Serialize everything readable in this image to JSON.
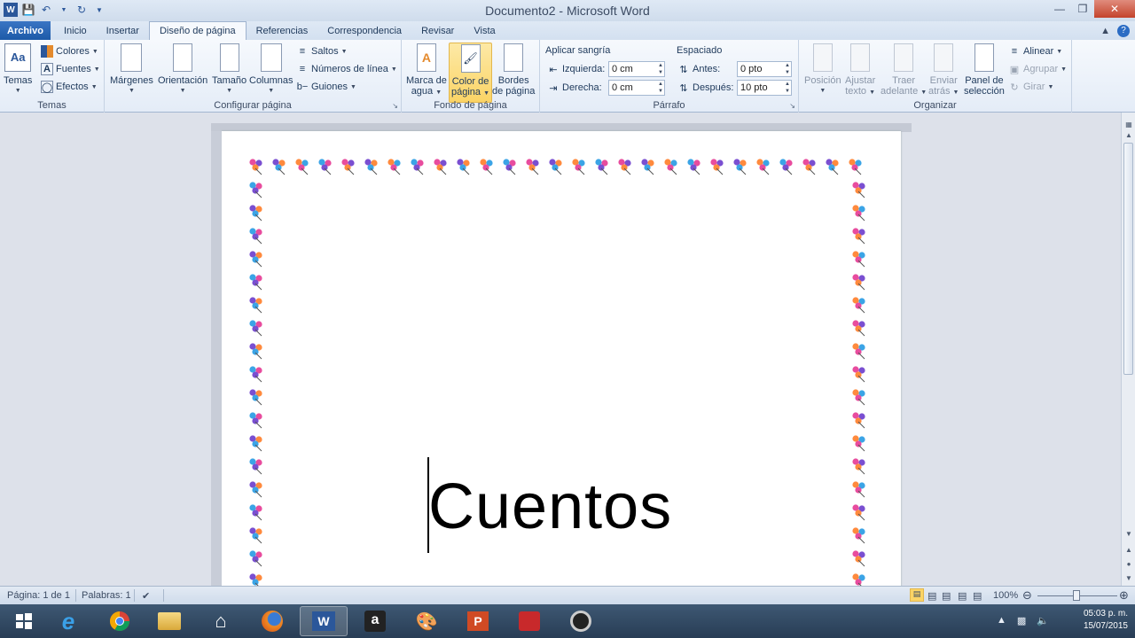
{
  "window": {
    "title": "Documento2  -  Microsoft Word"
  },
  "tabs": [
    {
      "label": "Archivo"
    },
    {
      "label": "Inicio"
    },
    {
      "label": "Insertar"
    },
    {
      "label": "Diseño de página"
    },
    {
      "label": "Referencias"
    },
    {
      "label": "Correspondencia"
    },
    {
      "label": "Revisar"
    },
    {
      "label": "Vista"
    }
  ],
  "ribbon": {
    "temas": {
      "label": "Temas",
      "temas_btn": "Temas",
      "colores": "Colores",
      "fuentes": "Fuentes",
      "efectos": "Efectos"
    },
    "configurar": {
      "label": "Configurar página",
      "margenes": "Márgenes",
      "orientacion": "Orientación",
      "tamano": "Tamaño",
      "columnas": "Columnas",
      "saltos": "Saltos",
      "numeros": "Números de línea",
      "guiones": "Guiones"
    },
    "fondo": {
      "label": "Fondo de página",
      "marca_l1": "Marca de",
      "marca_l2": "agua",
      "color_l1": "Color de",
      "color_l2": "página",
      "bordes_l1": "Bordes",
      "bordes_l2": "de página"
    },
    "parrafo": {
      "label": "Párrafo",
      "sangria_title": "Aplicar sangría",
      "izquierda_label": "Izquierda:",
      "izquierda_value": "0 cm",
      "derecha_label": "Derecha:",
      "derecha_value": "0 cm",
      "espaciado_title": "Espaciado",
      "antes_label": "Antes:",
      "antes_value": "0 pto",
      "despues_label": "Después:",
      "despues_value": "10 pto"
    },
    "organizar": {
      "label": "Organizar",
      "posicion": "Posición",
      "ajustar_l1": "Ajustar",
      "ajustar_l2": "texto",
      "traer_l1": "Traer",
      "traer_l2": "adelante",
      "enviar_l1": "Enviar",
      "enviar_l2": "atrás",
      "panel_l1": "Panel de",
      "panel_l2": "selección",
      "alinear": "Alinear",
      "agrupar": "Agrupar",
      "girar": "Girar"
    }
  },
  "document": {
    "text": "Cuentos"
  },
  "statusbar": {
    "pagina": "Página: 1 de 1",
    "palabras": "Palabras: 1",
    "zoom": "100%"
  },
  "taskbar": {
    "time": "05:03 p. m.",
    "date": "15/07/2015"
  },
  "colors": {
    "file_tab": "#2b579a",
    "highlight": "#fbd466",
    "border_flower": "#e040a0"
  }
}
